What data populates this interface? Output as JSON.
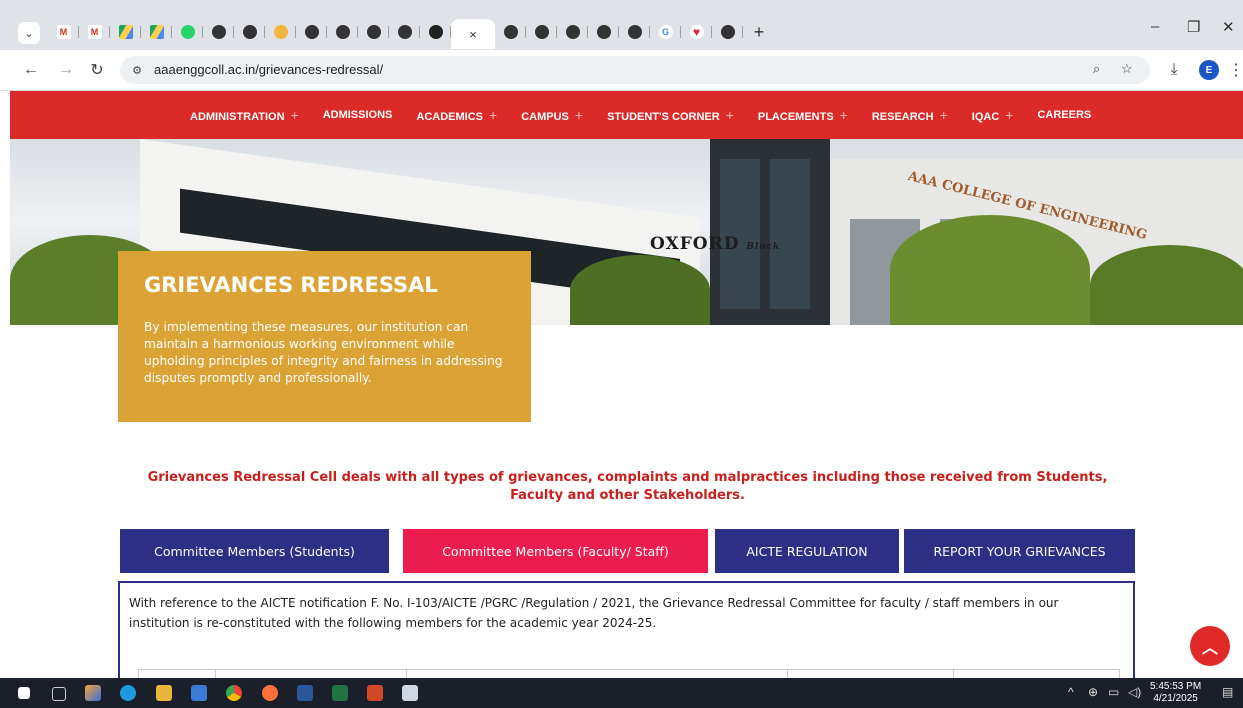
{
  "browser": {
    "tab_overflow_icon": "chevron-down-icon",
    "active_tab_close": "×",
    "new_tab_label": "+",
    "url": "aaaenggcoll.ac.in/grievances-redressal/",
    "profile_initial": "E",
    "window_minimize": "–",
    "window_restore": "❐",
    "window_close": "✕"
  },
  "nav": {
    "items": [
      {
        "label": "ADMINISTRATION",
        "plus": "+"
      },
      {
        "label": "ADMISSIONS",
        "plus": ""
      },
      {
        "label": "ACADEMICS",
        "plus": "+"
      },
      {
        "label": "CAMPUS",
        "plus": "+"
      },
      {
        "label": "STUDENT'S CORNER",
        "plus": "+"
      },
      {
        "label": "PLACEMENTS",
        "plus": "+"
      },
      {
        "label": "RESEARCH",
        "plus": "+"
      },
      {
        "label": "IQAC",
        "plus": "+"
      },
      {
        "label": "CAREERS",
        "plus": ""
      }
    ]
  },
  "hero": {
    "sign_oxford": "OXFORD",
    "sign_oxford_small": "Block",
    "sign_college": "AAA COLLEGE OF ENGINEERING"
  },
  "banner": {
    "title": "GRIEVANCES REDRESSAL",
    "description": "By implementing these measures, our institution can maintain a harmonious working environment while upholding principles of integrity and fairness in addressing disputes promptly and professionally."
  },
  "intro_text": "Grievances Redressal Cell deals with all types of grievances, complaints and malpractices including those received from Students, Faculty and other Stakeholders.",
  "tabs": [
    {
      "label": "Committee Members (Students)",
      "color": "#2d2f87"
    },
    {
      "label": "Committee Members (Faculty/ Staff)",
      "color": "#ed1c4e"
    },
    {
      "label": "AICTE REGULATION",
      "color": "#2d2f87"
    },
    {
      "label": "REPORT YOUR GRIEVANCES",
      "color": "#2d2f87"
    }
  ],
  "content": {
    "text": "With reference to the AICTE notification F. No. I-103/AICTE /PGRC /Regulation / 2021, the Grievance Redressal Committee for faculty / staff members in our institution is re-constituted with the following members for the academic year 2024-25."
  },
  "scroll_top_icon": "chevron-up-icon",
  "taskbar": {
    "time": "5:45:53 PM",
    "date": "4/21/2025"
  },
  "colors": {
    "nav_red": "#db2a27",
    "banner_gold": "#dba336",
    "intro_red": "#c8201e",
    "tab_navy": "#2d2f87",
    "tab_active": "#ed1c4e"
  }
}
